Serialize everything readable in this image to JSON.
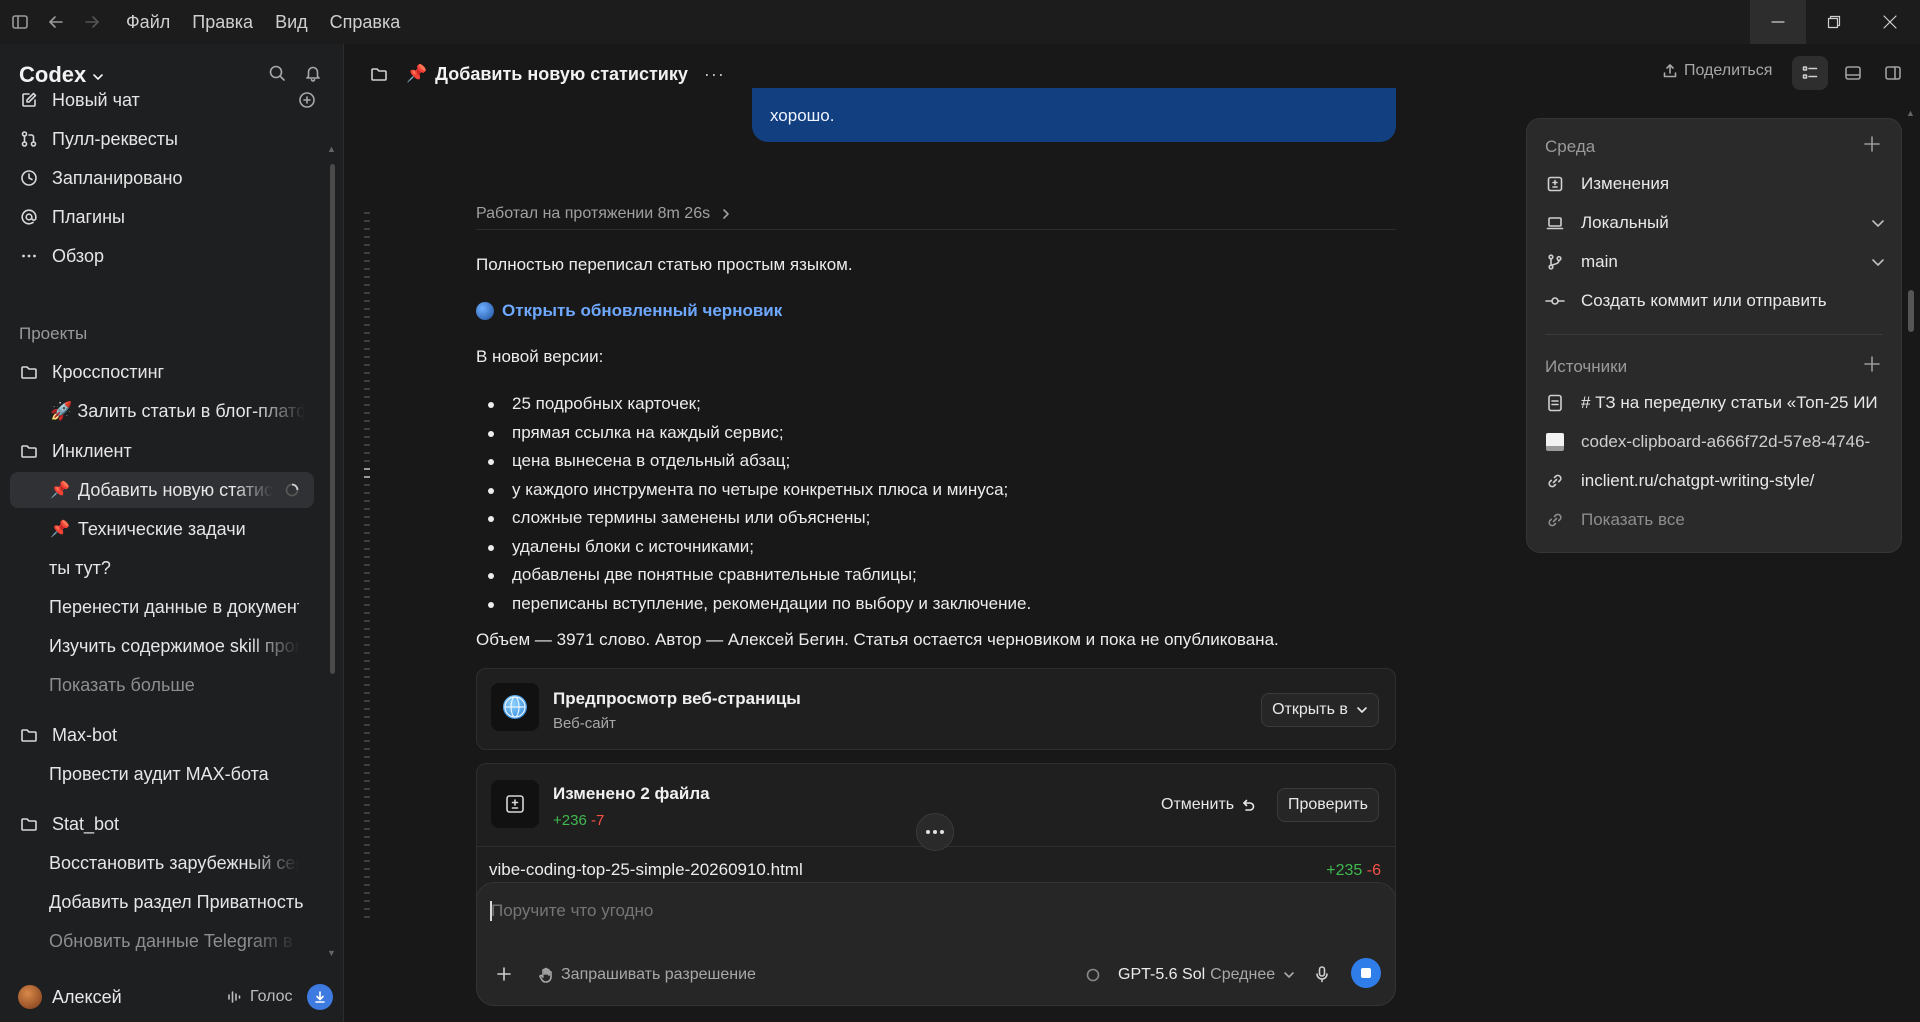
{
  "menu": [
    "Файл",
    "Правка",
    "Вид",
    "Справка"
  ],
  "app": {
    "name": "Codex"
  },
  "sidebar": {
    "nav": [
      {
        "label": "Новый чат",
        "icon": "edit-icon"
      },
      {
        "label": "Пулл-реквесты",
        "icon": "pull-request-icon"
      },
      {
        "label": "Запланировано",
        "icon": "clock-icon"
      },
      {
        "label": "Плагины",
        "icon": "at-icon"
      },
      {
        "label": "Обзор",
        "icon": "more-icon"
      }
    ],
    "projects_label": "Проекты",
    "projects": [
      {
        "name": "Кросспостинг",
        "chats": [
          "🚀 Залить статьи в блог-платфо"
        ]
      },
      {
        "name": "Инклиент",
        "chats": [
          "Добавить новую статис",
          "Технические задачи",
          "ты тут?",
          "Перенести данные в документ",
          "Изучить содержимое skill пром"
        ],
        "show_more": "Показать больше"
      },
      {
        "name": "Max-bot",
        "chats": [
          "Провести аудит MAX-бота"
        ]
      },
      {
        "name": "Stat_bot",
        "chats": [
          "Восстановить зарубежный серв",
          "Добавить раздел Приватность",
          "Обновить данные Telegram в .e"
        ]
      }
    ],
    "user": {
      "name": "Алексей",
      "voice": "Голос"
    }
  },
  "header": {
    "pin": "📌",
    "title": "Добавить новую статистику",
    "more": "···",
    "share": "Поделиться"
  },
  "chat": {
    "bubble_text": "хорошо.",
    "worked": "Работал на протяжении 8m 26s",
    "intro": "Полностью переписал статью простым языком.",
    "link": "Открыть обновленный черновик",
    "version_heading": "В новой версии:",
    "bullets": [
      "25 подробных карточек;",
      "прямая ссылка на каждый сервис;",
      "цена вынесена в отдельный абзац;",
      "у каждого инструмента по четыре конкретных плюса и минуса;",
      "сложные термины заменены или объяснены;",
      "удалены блоки с источниками;",
      "добавлены две понятные сравнительные таблицы;",
      "переписаны вступление, рекомендации по выбору и заключение."
    ],
    "summary": "Объем — 3971 слово. Автор — Алексей Бегин. Статья остается черновиком и пока не опубликована."
  },
  "preview_card": {
    "title": "Предпросмотр веб-страницы",
    "subtitle": "Веб-сайт",
    "open_btn": "Открыть в"
  },
  "changes_card": {
    "title": "Изменено 2 файла",
    "added": "+236",
    "removed": "-7",
    "undo": "Отменить",
    "review": "Проверить",
    "file": {
      "name": "vibe-coding-top-25-simple-20260910.html",
      "added": "+235",
      "removed": "-6"
    }
  },
  "composer": {
    "placeholder": "Поручите что угодно",
    "permission": "Запрашивать разрешение",
    "model": "GPT-5.6 Sol",
    "effort": "Среднее"
  },
  "env_panel": {
    "env_label": "Среда",
    "rows": [
      "Изменения",
      "Локальный",
      "main",
      "Создать коммит или отправить"
    ],
    "sources_label": "Источники",
    "sources": [
      "# ТЗ на переделку статьи «Топ-25 ИИ",
      "codex-clipboard-a666f72d-57e8-4746-",
      "inclient.ru/chatgpt-writing-style/"
    ],
    "show_all": "Показать все"
  },
  "colors": {
    "accent": "#3d7be0",
    "bubble": "#123f80",
    "added": "#3fb950",
    "removed": "#f85149",
    "link": "#6ea8ff"
  }
}
